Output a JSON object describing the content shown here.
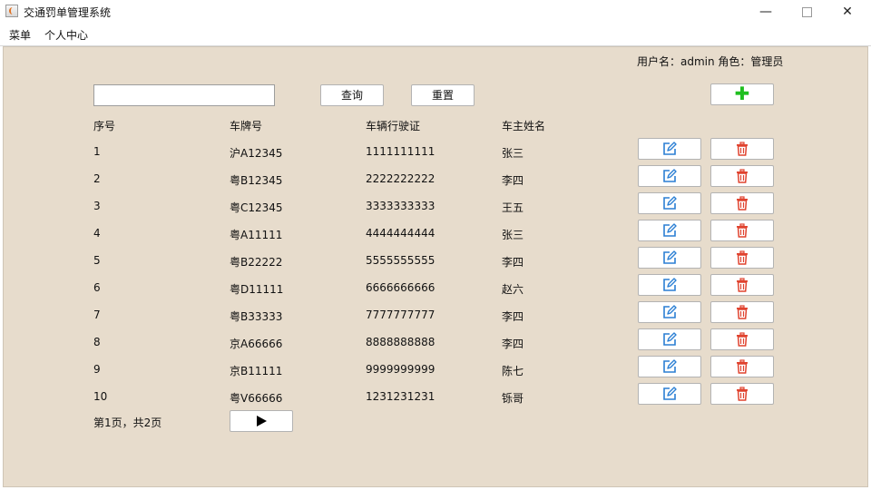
{
  "window": {
    "title": "交通罚单管理系统",
    "minimize": "—",
    "close": "✕"
  },
  "menubar": {
    "items": [
      "菜单",
      "个人中心"
    ]
  },
  "user": {
    "info": "用户名：admin 角色：管理员"
  },
  "search": {
    "value": "",
    "placeholder": ""
  },
  "toolbar": {
    "query_label": "查询",
    "reset_label": "重置",
    "add_icon": "plus-icon"
  },
  "table": {
    "headers": [
      "序号",
      "车牌号",
      "车辆行驶证",
      "车主姓名"
    ],
    "rows": [
      [
        "1",
        "沪A12345",
        "1111111111",
        "张三"
      ],
      [
        "2",
        "粤B12345",
        "2222222222",
        "李四"
      ],
      [
        "3",
        "粤C12345",
        "3333333333",
        "王五"
      ],
      [
        "4",
        "粤A11111",
        "4444444444",
        "张三"
      ],
      [
        "5",
        "粤B22222",
        "5555555555",
        "李四"
      ],
      [
        "6",
        "粤D11111",
        "6666666666",
        "赵六"
      ],
      [
        "7",
        "粤B33333",
        "7777777777",
        "李四"
      ],
      [
        "8",
        "京A66666",
        "8888888888",
        "李四"
      ],
      [
        "9",
        "京B11111",
        "9999999999",
        "陈七"
      ],
      [
        "10",
        "粤V66666",
        "1231231231",
        "铄哥"
      ]
    ],
    "row_actions": [
      "edit-icon",
      "trash-icon"
    ]
  },
  "pagination": {
    "info": "第1页，共2页",
    "next_icon": "play-icon"
  },
  "colors": {
    "background": "#e7dccc",
    "add": "#1fbf1f",
    "edit": "#2b7fd4",
    "delete": "#e0432f"
  }
}
